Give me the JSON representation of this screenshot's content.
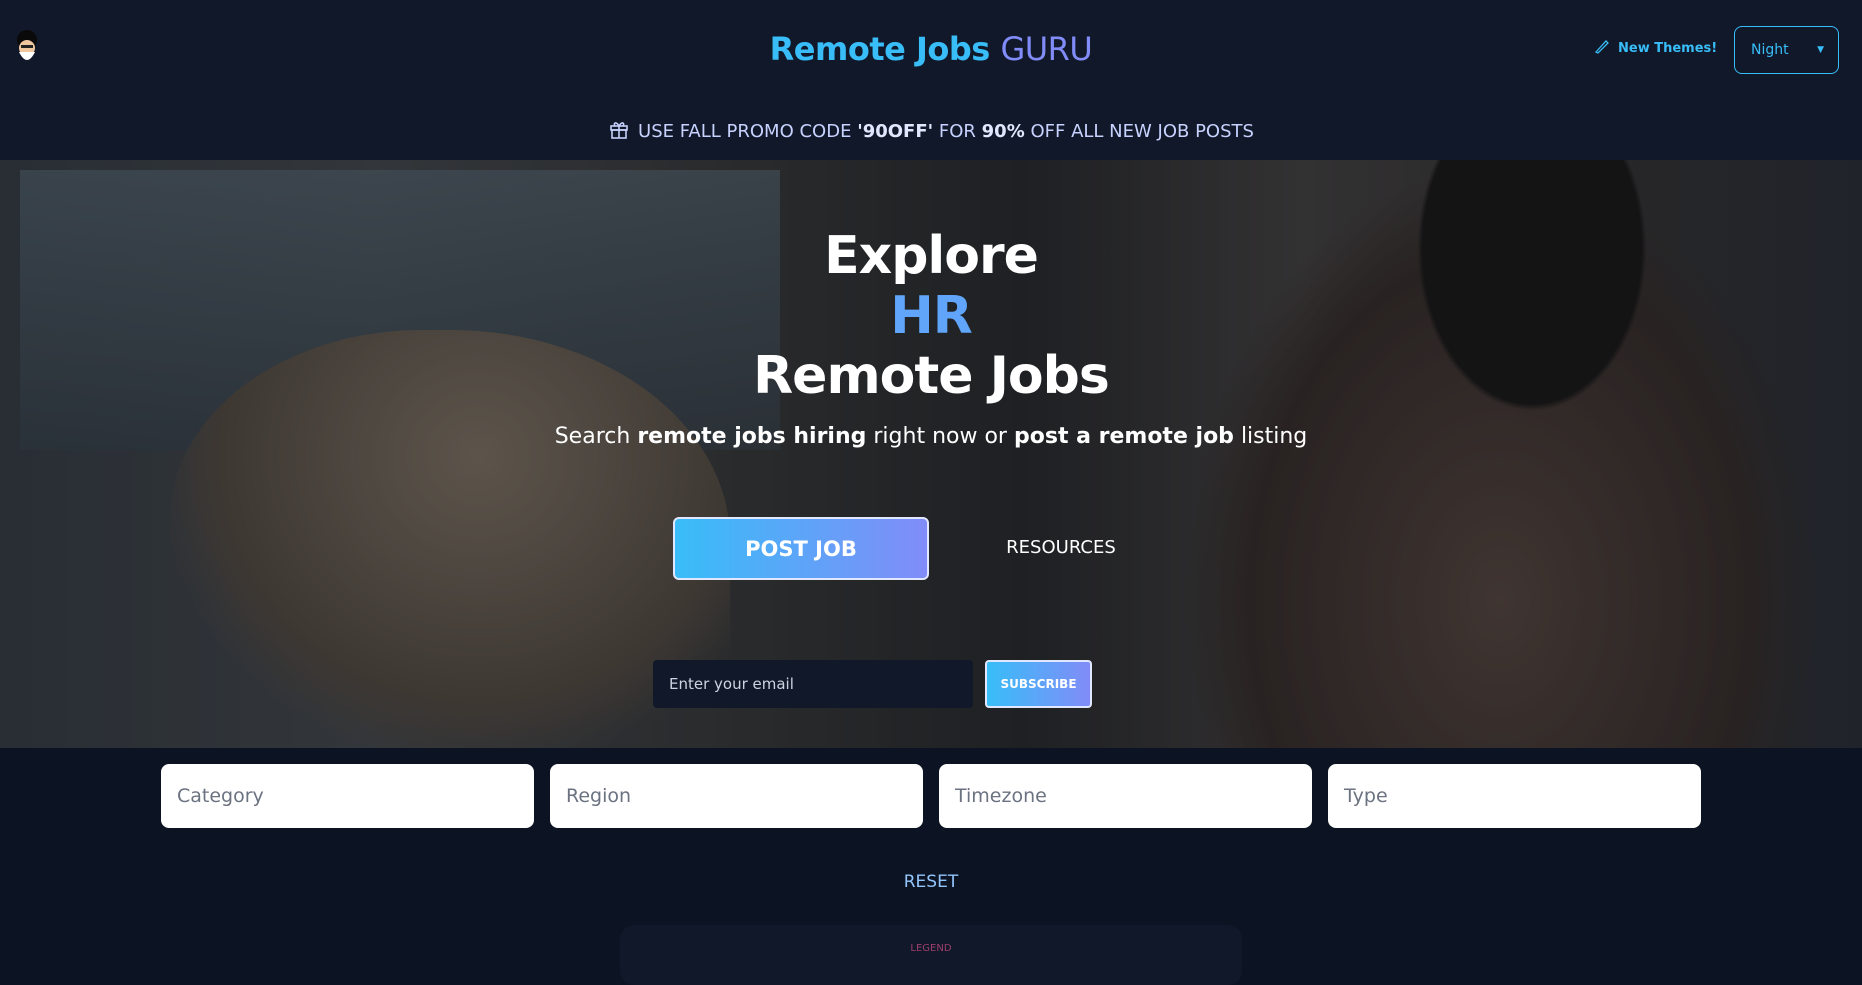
{
  "header": {
    "title_main": "Remote Jobs",
    "title_accent": "GURU",
    "new_themes": "New Themes!",
    "theme_select": "Night"
  },
  "promo": {
    "prefix": "USE FALL PROMO CODE",
    "code": "'90OFF'",
    "mid": "FOR",
    "discount": "90%",
    "suffix": "OFF ALL NEW JOB POSTS"
  },
  "hero": {
    "line1": "Explore",
    "line2": "HR",
    "line3": "Remote Jobs",
    "subtitle": {
      "t1": "Search",
      "b1": "remote jobs hiring",
      "t2": "right now or",
      "b2": "post a remote job",
      "t3": "listing"
    },
    "post_job": "POST JOB",
    "resources": "RESOURCES",
    "email_placeholder": "Enter your email",
    "subscribe": "SUBSCRIBE"
  },
  "filters": [
    "Category",
    "Region",
    "Timezone",
    "Type"
  ],
  "reset": "RESET",
  "legend": {
    "title": "LEGEND"
  },
  "colors": {
    "accent": "#38bdf8",
    "accent2": "#818cf8",
    "background": "#0c1322"
  }
}
